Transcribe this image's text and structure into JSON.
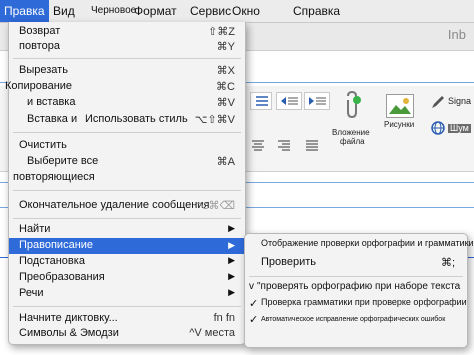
{
  "menubar": {
    "items": [
      "Правка",
      "Вид",
      "Черновое",
      "Формат",
      "Сервис",
      "Окно",
      "Справка"
    ]
  },
  "window": {
    "title_fragment": "Inb"
  },
  "ribbon": {
    "attach_label_1": "Вложение",
    "attach_label_2": "файла",
    "pictures_label": "Рисунки",
    "signature_label": "Signa",
    "style_label": "Шум"
  },
  "menu": {
    "items": [
      {
        "label_1": "Возврат",
        "label_2": "повтора",
        "shortcut_1": "⇧⌘Z",
        "shortcut_2": "⌘Y"
      },
      {
        "label_1": "Вырезать",
        "shortcut": "⌘X"
      },
      {
        "label_1": "Копирование",
        "shortcut": "⌘C"
      },
      {
        "label_1": "и вставка",
        "shortcut": "⌘V"
      },
      {
        "label_1": "Вставка и",
        "label_2": "Использовать стиль",
        "shortcut": "⌥⇧⌘V"
      },
      {
        "label_1": "Очистить"
      },
      {
        "label_1": "Выберите все",
        "label_2": "повторяющиеся",
        "shortcut": "⌘A"
      },
      {
        "label_1": "Окончательное удаление сообщения",
        "shortcut": "⌥⌘⌫"
      },
      {
        "label_1": "Найти"
      },
      {
        "label_1": "Правописание"
      },
      {
        "label_1": "Подстановка"
      },
      {
        "label_1": "Преобразования"
      },
      {
        "label_1": "Речи"
      },
      {
        "label_1": "Начните диктовку...",
        "shortcut": "fn fn"
      },
      {
        "label_1": "Символы & Эмодзи",
        "shortcut": "^V места"
      }
    ]
  },
  "submenu": {
    "items": [
      {
        "label": "Отображение проверки орфографии и грамматики",
        "checked": ""
      },
      {
        "label": "Проверить",
        "shortcut": "⌘;",
        "checked": ""
      },
      {
        "label": "\"проверять орфографию при наборе текста",
        "checked": "v"
      },
      {
        "label": "Проверка грамматики при проверке орфографии",
        "checked": "✓"
      },
      {
        "label": "Автоматическое исправление орфографических ошибок",
        "checked": "✓"
      }
    ]
  },
  "colors": {
    "highlight": "#2f6ad9",
    "menu_bg": "#f3f3f3"
  }
}
